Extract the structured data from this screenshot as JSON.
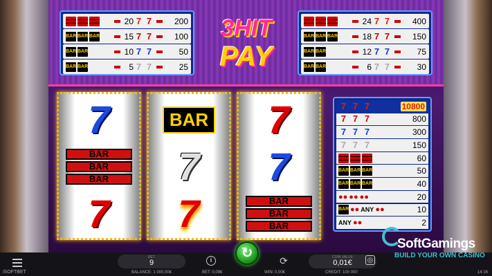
{
  "game": {
    "logo_line1": "3HIT",
    "logo_line2": "PAY"
  },
  "paytable_left": [
    {
      "symbols": [
        "bar3",
        "bar3",
        "bar3"
      ],
      "v1": "20",
      "special": "seven-f",
      "v2": "200"
    },
    {
      "symbols": [
        "bar",
        "bar",
        "bar"
      ],
      "v1": "15",
      "special": "seven-r",
      "v2": "100"
    },
    {
      "symbols": [
        "BAR",
        "BAR"
      ],
      "v1": "10",
      "special": "seven-b",
      "v2": "50"
    },
    {
      "symbols": [
        "BAR",
        "BAR"
      ],
      "v1": "5",
      "special": "seven-w",
      "v2": "25"
    }
  ],
  "paytable_right": [
    {
      "v1": "24",
      "v2": "400"
    },
    {
      "v1": "18",
      "v2": "150"
    },
    {
      "v1": "12",
      "v2": "75"
    },
    {
      "v1": "6",
      "v2": "30"
    }
  ],
  "paytable_big": [
    {
      "label": "fire-sevens",
      "value": "10800"
    },
    {
      "label": "red-sevens",
      "value": "800"
    },
    {
      "label": "blue-sevens",
      "value": "300"
    },
    {
      "label": "white-sevens",
      "value": "150"
    },
    {
      "label": "triple-bars",
      "value": "60"
    },
    {
      "label": "double-bars",
      "value": "50"
    },
    {
      "label": "single-bars",
      "value": "40"
    },
    {
      "label": "three-cherries",
      "value": "20"
    },
    {
      "label": "two-cherries",
      "value": "10",
      "any": "ANY"
    },
    {
      "label": "one-cherry",
      "value": "2",
      "any": "ANY"
    }
  ],
  "reels": {
    "bar_single": "BAR",
    "bar_triple": [
      "BAR",
      "BAR",
      "BAR"
    ]
  },
  "controls": {
    "bet_label": "BET",
    "bet_value": "9",
    "coin_label": "COIN VALUE",
    "coin_value": "0,01€",
    "brand": "iSOFTBET"
  },
  "status": {
    "balance": "BALANCE: 1 000,00€",
    "bet": "BET: 0,09€",
    "win": "WIN: 0,00€",
    "credit": "CREDIT: 100 000",
    "time": "14:16"
  },
  "watermark": {
    "name": "SoftGamings",
    "sub": "BUILD YOUR OWN CASINO"
  }
}
